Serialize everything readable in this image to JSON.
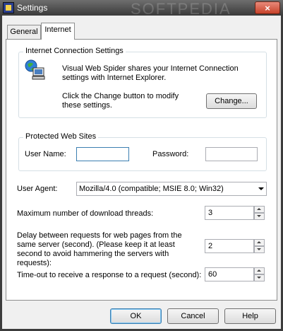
{
  "window": {
    "title": "Settings",
    "watermark": "SOFTPEDIA",
    "close_label": "×"
  },
  "tabs": [
    {
      "label": "General",
      "active": false
    },
    {
      "label": "Internet",
      "active": true
    }
  ],
  "internet_connection": {
    "group_title": "Internet Connection Settings",
    "icon": "network-computer-icon",
    "description": "Visual Web Spider shares your Internet Connection settings with Internet Explorer.",
    "instruction": "Click the Change button to modify these settings.",
    "change_button": "Change..."
  },
  "protected_sites": {
    "group_title": "Protected Web Sites",
    "username_label": "User Name:",
    "username_value": "",
    "password_label": "Password:",
    "password_value": ""
  },
  "user_agent": {
    "label": "User Agent:",
    "value": "Mozilla/4.0 (compatible; MSIE 8.0; Win32)"
  },
  "threads": {
    "label": "Maximum number of download threads:",
    "value": "3"
  },
  "delay": {
    "label": "Delay between requests for web pages from the same server (second). (Please keep it at least second to avoid hammering the servers with requests):",
    "value": "2"
  },
  "timeout": {
    "label": "Time-out to receive a response to a request (second):",
    "value": "60"
  },
  "buttons": {
    "ok": "OK",
    "cancel": "Cancel",
    "help": "Help"
  }
}
